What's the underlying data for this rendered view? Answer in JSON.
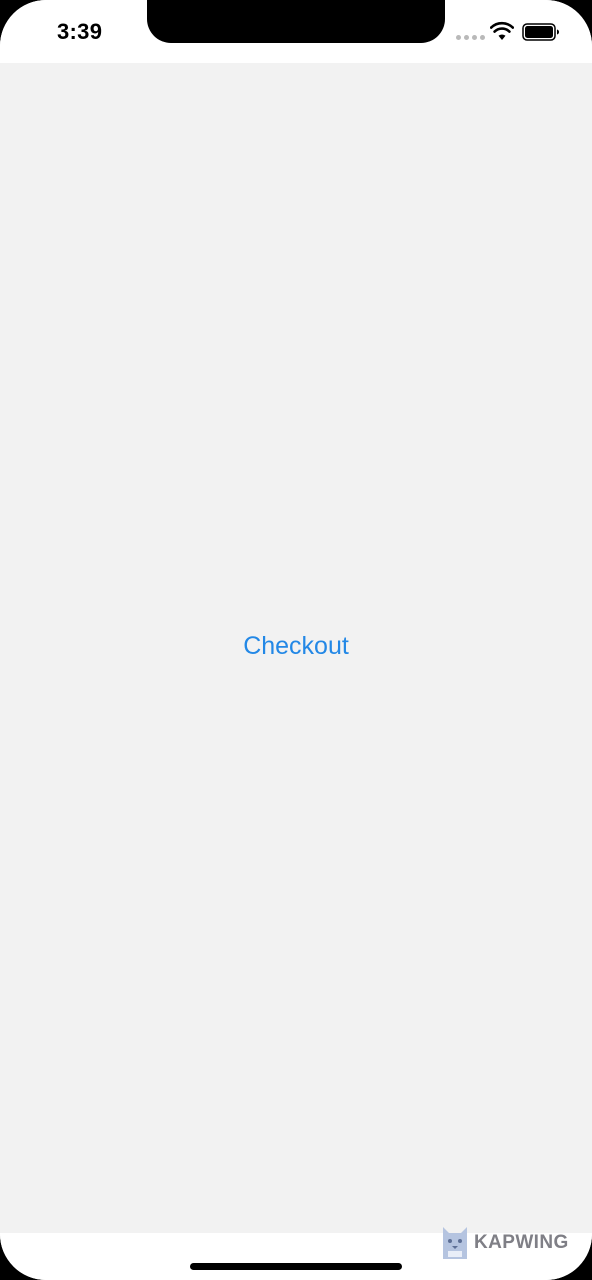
{
  "status_bar": {
    "time": "3:39"
  },
  "main": {
    "checkout_label": "Checkout",
    "accent_color": "#2388e6",
    "background_color": "#f2f2f2"
  },
  "watermark": {
    "text": "KAPWING"
  }
}
